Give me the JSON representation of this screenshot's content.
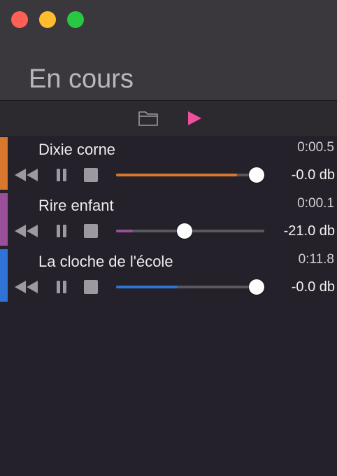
{
  "window": {
    "title": "En cours"
  },
  "toolbar": {
    "open_icon": "folder-icon",
    "play_icon": "play-icon",
    "play_color": "#f04f9e"
  },
  "tracks": [
    {
      "name": "Dixie corne",
      "time": "0:00.5",
      "db": "-0.0 db",
      "color": "#d9782d",
      "progress": 0.86,
      "volume": 1.0
    },
    {
      "name": "Rire enfant",
      "time": "0:00.1",
      "db": "-21.0 db",
      "color": "#9a4f9b",
      "progress": 0.12,
      "volume": 0.46
    },
    {
      "name": "La cloche de l'école",
      "time": "0:11.8",
      "db": "-0.0 db",
      "color": "#2f73d6",
      "progress": 0.44,
      "volume": 1.0
    }
  ]
}
